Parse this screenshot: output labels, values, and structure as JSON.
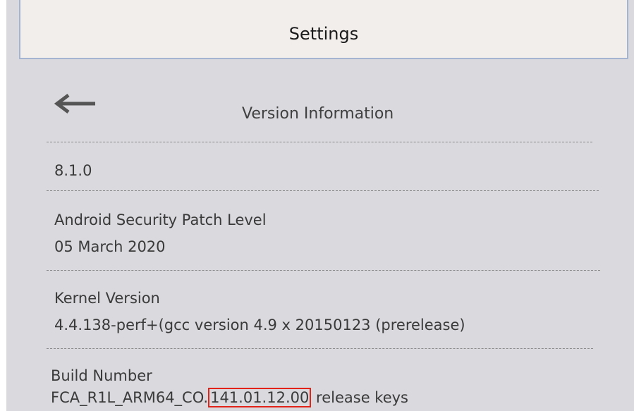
{
  "title_bar": {
    "title": "Settings"
  },
  "version_info": {
    "heading": "Version Information",
    "android_version": "8.1.0",
    "security_patch": {
      "label": "Android Security Patch Level",
      "value": "05 March 2020"
    },
    "kernel": {
      "label": "Kernel Version",
      "value": "4.4.138-perf+(gcc version 4.9 x 20150123 (prerelease)"
    },
    "build": {
      "label": "Build Number",
      "prefix": "FCA_R1L_ARM64_CO.",
      "highlighted": "141.01.12.00",
      "suffix": "release keys"
    }
  },
  "colors": {
    "screen_background": "#d9d9de",
    "title_background": "#f2eeec",
    "title_border": "#a5b4d0",
    "highlight_box": "#e2231a"
  },
  "icons": {
    "back": "left-arrow-icon"
  }
}
